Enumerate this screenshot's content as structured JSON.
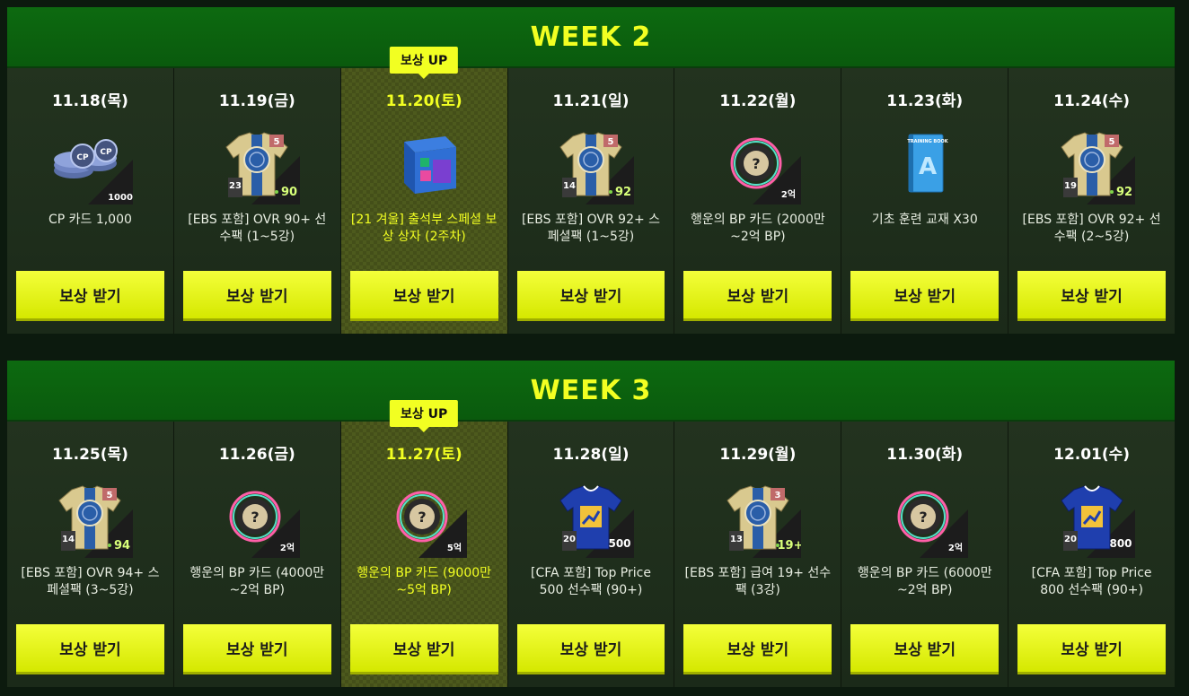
{
  "weeks": [
    {
      "title": "WEEK 2",
      "days": [
        {
          "date": "11.18(목)",
          "desc": "CP 카드 1,000",
          "icon": "cp-coins",
          "num": "1000"
        },
        {
          "date": "11.19(금)",
          "desc": "[EBS 포함] OVR 90+ 선수팩 (1~5강)",
          "icon": "jersey",
          "grade": "5",
          "level": "23",
          "ovr": "90"
        },
        {
          "date": "11.20(토)",
          "desc": "[21 겨울] 출석부 스페셜 보상 상자 (2주차)",
          "icon": "box",
          "badge": "보상 UP",
          "special": true
        },
        {
          "date": "11.21(일)",
          "desc": "[EBS 포함] OVR 92+ 스페셜팩 (1~5강)",
          "icon": "jersey",
          "grade": "5",
          "level": "14",
          "ovr": "92"
        },
        {
          "date": "11.22(월)",
          "desc": "행운의 BP 카드 (2000만 ~2억 BP)",
          "icon": "bp-card",
          "amount": "2억"
        },
        {
          "date": "11.23(화)",
          "desc": "기초 훈련 교재 X30",
          "icon": "book",
          "book_title": "TRAINING BOOK",
          "letter": "A"
        },
        {
          "date": "11.24(수)",
          "desc": "[EBS 포함] OVR 92+ 선수팩 (2~5강)",
          "icon": "jersey",
          "grade": "5",
          "level": "19",
          "ovr": "92"
        }
      ]
    },
    {
      "title": "WEEK 3",
      "days": [
        {
          "date": "11.25(목)",
          "desc": "[EBS 포함] OVR 94+ 스페셜팩 (3~5강)",
          "icon": "jersey",
          "grade": "5",
          "level": "14",
          "ovr": "94"
        },
        {
          "date": "11.26(금)",
          "desc": "행운의 BP 카드 (4000만 ~2억 BP)",
          "icon": "bp-card",
          "amount": "2억"
        },
        {
          "date": "11.27(토)",
          "desc": "행운의 BP 카드 (9000만 ~5억 BP)",
          "icon": "bp-card",
          "amount": "5억",
          "badge": "보상 UP",
          "special": true
        },
        {
          "date": "11.28(일)",
          "desc": "[CFA 포함] Top Price 500 선수팩 (90+)",
          "icon": "blue-jersey",
          "level": "20",
          "price": "500"
        },
        {
          "date": "11.29(월)",
          "desc": "[EBS 포함] 급여 19+ 선수팩 (3강)",
          "icon": "jersey",
          "grade": "3",
          "level": "13",
          "ovr": "19+"
        },
        {
          "date": "11.30(화)",
          "desc": "행운의 BP 카드 (6000만 ~2억 BP)",
          "icon": "bp-card",
          "amount": "2억"
        },
        {
          "date": "12.01(수)",
          "desc": "[CFA 포함] Top Price 800 선수팩 (90+)",
          "icon": "blue-jersey",
          "level": "20",
          "price": "800"
        }
      ]
    }
  ],
  "claim_label": "보상 받기",
  "colors": {
    "accent": "#f2ff22",
    "header_green": "#0d6a10",
    "panel": "#23331f"
  }
}
